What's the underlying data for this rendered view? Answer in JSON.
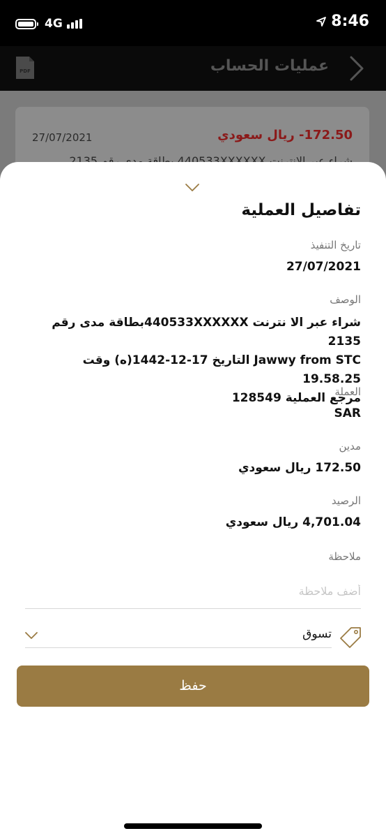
{
  "status_bar": {
    "network": "4G",
    "time": "8:46"
  },
  "header": {
    "title": "عمليات الحساب",
    "pdf_label": "PDF"
  },
  "background_transaction": {
    "date": "27/07/2021",
    "amount": "172.50- ريال سعودي",
    "description": "شراء عبر الانترنت 440533XXXXXX بطاقة مدى رقم 2135"
  },
  "details": {
    "title": "تفاصيل العملية",
    "execution_date_label": "تاريخ التنفيذ",
    "execution_date_value": "27/07/2021",
    "description_label": "الوصف",
    "description_lines": [
      "شراء عبر الا نترنت 440533XXXXXXبطاقة مدى رقم 2135",
      "Jawwy from STC التاريخ 17-12-1442(ه) وقت 19.58.25",
      "مرجع العملية 128549"
    ],
    "currency_label": "العملة",
    "currency_value": "SAR",
    "debit_label": "مدين",
    "debit_value": "172.50 ريال سعودي",
    "balance_label": "الرصيد",
    "balance_value": "4,701.04 ريال سعودي",
    "note_label": "ملاحظة",
    "note_placeholder": "أضف ملاحظة",
    "category_value": "تسوق",
    "save_label": "حفظ"
  },
  "colors": {
    "accent": "#9a7b43",
    "negative": "#8b1a1a"
  },
  "icons": {
    "back": "chevron-right-icon",
    "pdf": "pdf-icon",
    "collapse": "chevron-down-icon",
    "tag": "tag-icon",
    "location": "location-arrow-icon"
  }
}
